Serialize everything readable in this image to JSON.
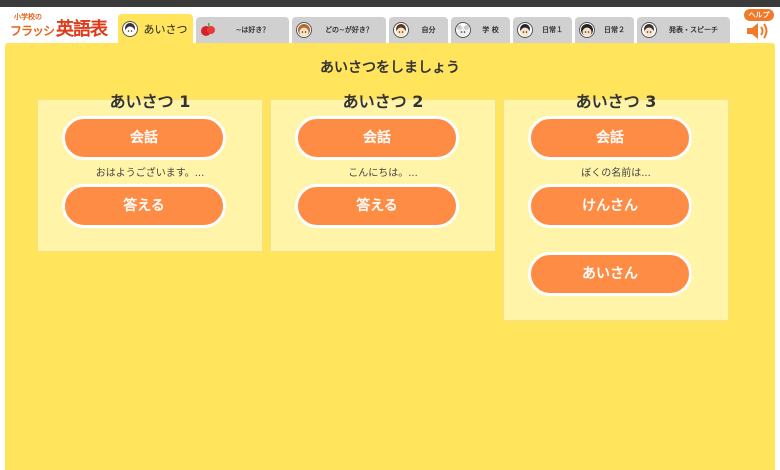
{
  "logo": {
    "small": "小学校の",
    "kana": "フラッシュ",
    "big": "英語表現"
  },
  "tabs": [
    {
      "label": "あいさつ",
      "icon": "boy-face-icon",
      "active": true
    },
    {
      "label": "~は好き？",
      "icon": "apple-icon",
      "active": false
    },
    {
      "label": "どの~が好き？",
      "icon": "girl-face-icon",
      "active": false
    },
    {
      "label": "自分",
      "icon": "boy-face-icon",
      "active": false
    },
    {
      "label": "学 校",
      "icon": "animal-icon",
      "active": false
    },
    {
      "label": "日常１",
      "icon": "boy-face-icon",
      "active": false
    },
    {
      "label": "日常２",
      "icon": "girl-face-icon",
      "active": false
    },
    {
      "label": "発表・スピーチ",
      "icon": "boy-face-icon",
      "active": false
    }
  ],
  "help_label": "ヘルプ",
  "heading": "あいさつをしましょう",
  "cards": [
    {
      "title": "あいさつ 1",
      "btn1": "会話",
      "caption": "おはようございます。...",
      "btn2": "答える"
    },
    {
      "title": "あいさつ 2",
      "btn1": "会話",
      "caption": "こんにちは。...",
      "btn2": "答える"
    },
    {
      "title": "あいさつ 3",
      "btn1": "会話",
      "caption": "ぼくの名前は...",
      "btn2": "けんさん",
      "btn3": "あいさん"
    }
  ],
  "colors": {
    "panel": "#ffe45c",
    "card": "#fff4a8",
    "button": "#ff8c44",
    "tab_inactive": "#d0d0d0"
  }
}
